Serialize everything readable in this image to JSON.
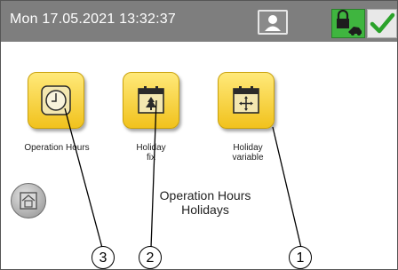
{
  "header": {
    "datetime": "Mon 17.05.2021  13:32:37",
    "user_icon": "user-icon",
    "lock_icon": "lock-icon",
    "check_icon": "check-icon"
  },
  "tiles": [
    {
      "label": "Operation Hours",
      "icon": "clock-icon"
    },
    {
      "label": "Holiday fix",
      "icon": "calendar-tree-icon"
    },
    {
      "label": "Holiday variable",
      "icon": "calendar-arrows-icon"
    }
  ],
  "home_icon": "home-icon",
  "page_title": {
    "line1": "Operation Hours",
    "line2": "Holidays"
  },
  "callouts": [
    "3",
    "2",
    "1"
  ],
  "colors": {
    "header": "#7e7e7e",
    "tile": "#f5d02f",
    "confirm": "#3fb53f"
  }
}
